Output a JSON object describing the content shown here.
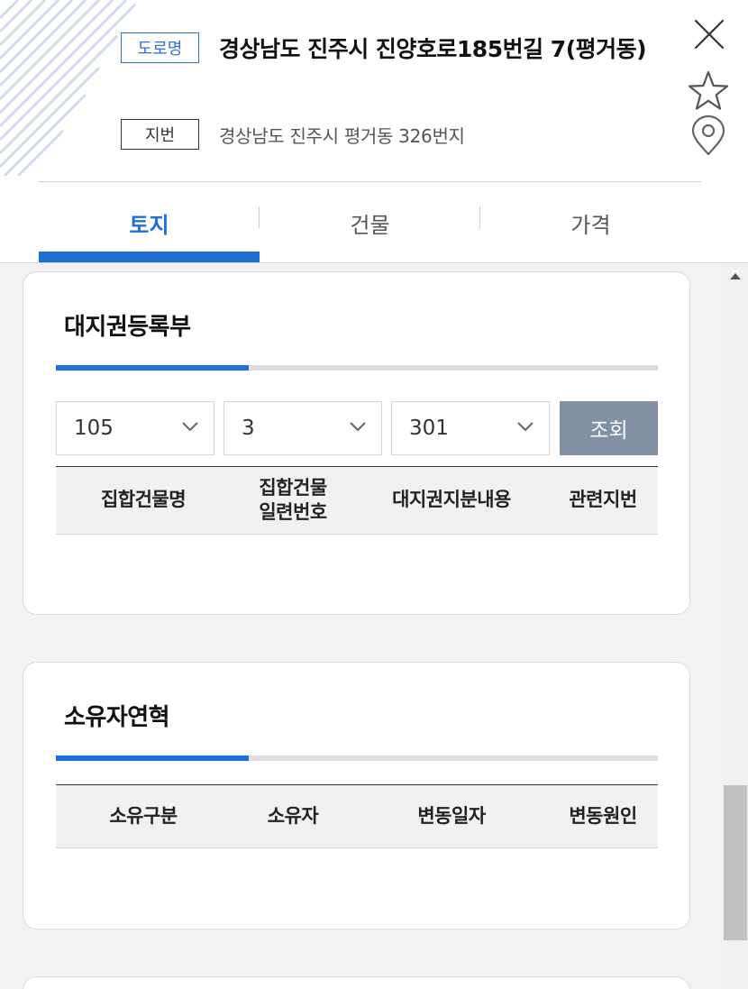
{
  "address": {
    "road_badge": "도로명",
    "road_address": "경상남도 진주시 진양호로185번길 7(평거동)",
    "jibun_badge": "지번",
    "jibun_address": "경상남도 진주시 평거동 326번지"
  },
  "header_icons": [
    "close-icon",
    "star-icon",
    "location-pin-icon"
  ],
  "tabs": [
    {
      "label": "토지",
      "active": true
    },
    {
      "label": "건물",
      "active": false
    },
    {
      "label": "가격",
      "active": false
    }
  ],
  "land_rights_registry": {
    "title": "대지권등록부",
    "progress": 0.32,
    "selects": [
      {
        "value": "105"
      },
      {
        "value": "3"
      },
      {
        "value": "301"
      }
    ],
    "query_button": "조회",
    "columns": [
      "집합건물명",
      "집합건물\n일련번호",
      "대지권지분내용",
      "관련지번"
    ]
  },
  "ownership_history": {
    "title": "소유자연혁",
    "progress": 0.32,
    "columns": [
      "소유구분",
      "소유자",
      "변동일자",
      "변동원인"
    ]
  },
  "colors": {
    "accent": "#1f6fd7",
    "query_button": "#8190a4",
    "background": "#f2f2f2"
  }
}
